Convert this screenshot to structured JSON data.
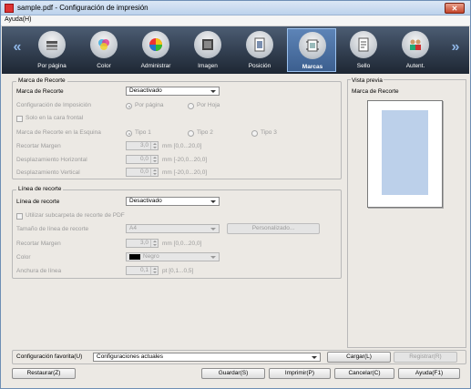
{
  "window": {
    "title": "sample.pdf - Configuración de impresión",
    "close_glyph": "✕"
  },
  "menu": {
    "help": "Ayuda(H)"
  },
  "toolbar": {
    "prev_glyph": "«",
    "next_glyph": "»",
    "items": [
      {
        "label": "Por página",
        "icon": "pages-stack-icon"
      },
      {
        "label": "Color",
        "icon": "color-circles-icon"
      },
      {
        "label": "Administrar",
        "icon": "color-wheel-icon"
      },
      {
        "label": "Imagen",
        "icon": "image-icon"
      },
      {
        "label": "Posición",
        "icon": "position-icon"
      },
      {
        "label": "Marcas",
        "icon": "crop-marks-icon",
        "active": true
      },
      {
        "label": "Sello",
        "icon": "stamp-icon"
      },
      {
        "label": "Autent.",
        "icon": "authentication-icon"
      }
    ]
  },
  "crop_marks": {
    "group_title": "Marca de Recorte",
    "mark_label": "Marca de Recorte",
    "mark_value": "Desactivado",
    "imposition_label": "Configuración de Imposición",
    "imposition_options": [
      "Por página",
      "Por Hoja"
    ],
    "front_only": "Solo en la cara frontal",
    "corner_label": "Marca de Recorte en la Esquina",
    "corner_options": [
      "Tipo 1",
      "Tipo 2",
      "Tipo 3"
    ],
    "margin_label": "Recortar Margen",
    "margin_value": "3,0",
    "margin_range": "mm [0,0...20,0]",
    "hshift_label": "Desplazamiento Horizontal",
    "hshift_value": "0,0",
    "hshift_range": "mm [-20,0...20,0]",
    "vshift_label": "Desplazamiento Vertical",
    "vshift_value": "0,0",
    "vshift_range": "mm [-20,0...20,0]"
  },
  "trim_line": {
    "group_title": "Línea de recorte",
    "line_label": "Línea de recorte",
    "line_value": "Desactivado",
    "use_pdf_sub": "Utilizar subcarpeta de recorte de PDF",
    "size_label": "Tamaño de línea de recorte",
    "size_value": "A4",
    "custom_button": "Personalizado...",
    "margin_label": "Recortar Margen",
    "margin_value": "3,0",
    "margin_range": "mm [0,0...20,0]",
    "color_label": "Color",
    "color_value": "Negro",
    "width_label": "Anchura de línea",
    "width_value": "0,1",
    "width_range": "pt [0,1...0,5]"
  },
  "preview": {
    "group_title": "Vista previa",
    "label": "Marca de Recorte"
  },
  "favorites": {
    "label": "Configuración favorita(U)",
    "value": "Configuraciones actuales",
    "load_button": "Cargar(L)",
    "register_button": "Registrar(R)"
  },
  "footer": {
    "restore": "Restaurar(Z)",
    "save": "Guardar(S)",
    "print": "Imprimir(P)",
    "cancel": "Cancelar(C)",
    "help": "Ayuda(F1)"
  },
  "colors": {
    "accent": "#3c5f8f",
    "toolbar_bg": "#2f3b4c",
    "preview_content": "#bcd0ea"
  }
}
